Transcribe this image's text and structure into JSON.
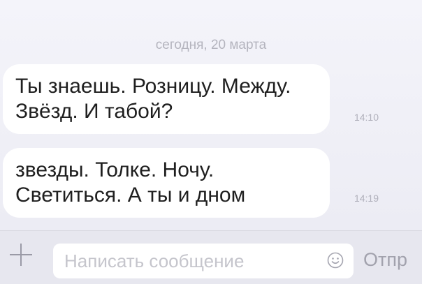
{
  "chat": {
    "date_separator": "сегодня, 20 марта",
    "messages": [
      {
        "lines": [
          "Ты знаешь. Розницу. Между.",
          "Звёзд. И табой?"
        ],
        "time": "14:10"
      },
      {
        "lines": [
          "звезды. Толке. Ночу.",
          "Светиться. А ты и дном"
        ],
        "time": "14:19"
      }
    ]
  },
  "composer": {
    "add_icon": "plus-icon",
    "placeholder": "Написать сообщение",
    "emoji_icon": "smile-icon",
    "send_label": "Отпр"
  }
}
